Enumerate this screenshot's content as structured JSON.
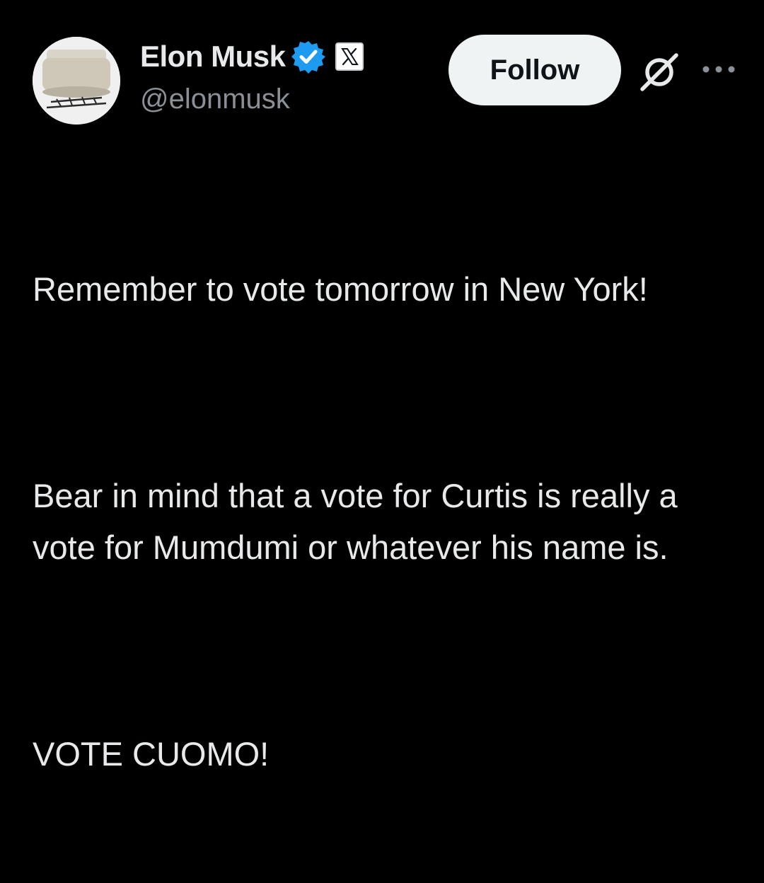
{
  "colors": {
    "background": "#000000",
    "text_primary": "#e7e9ea",
    "text_secondary": "#8b9096",
    "verified_blue": "#1d9bf0",
    "follow_button_bg": "#eff3f4"
  },
  "author": {
    "display_name": "Elon Musk",
    "handle": "@elonmusk",
    "verified_icon": "verified-badge-icon",
    "affiliate_icon": "x-logo-icon"
  },
  "actions": {
    "follow_label": "Follow",
    "grok_icon": "grok-icon",
    "more_icon": "more-options-icon"
  },
  "tweet": {
    "paragraphs": [
      "Remember to vote tomorrow in New York!",
      "Bear in mind that a vote for Curtis is really a vote for Mumdumi or whatever his name is.",
      "VOTE CUOMO!"
    ]
  }
}
